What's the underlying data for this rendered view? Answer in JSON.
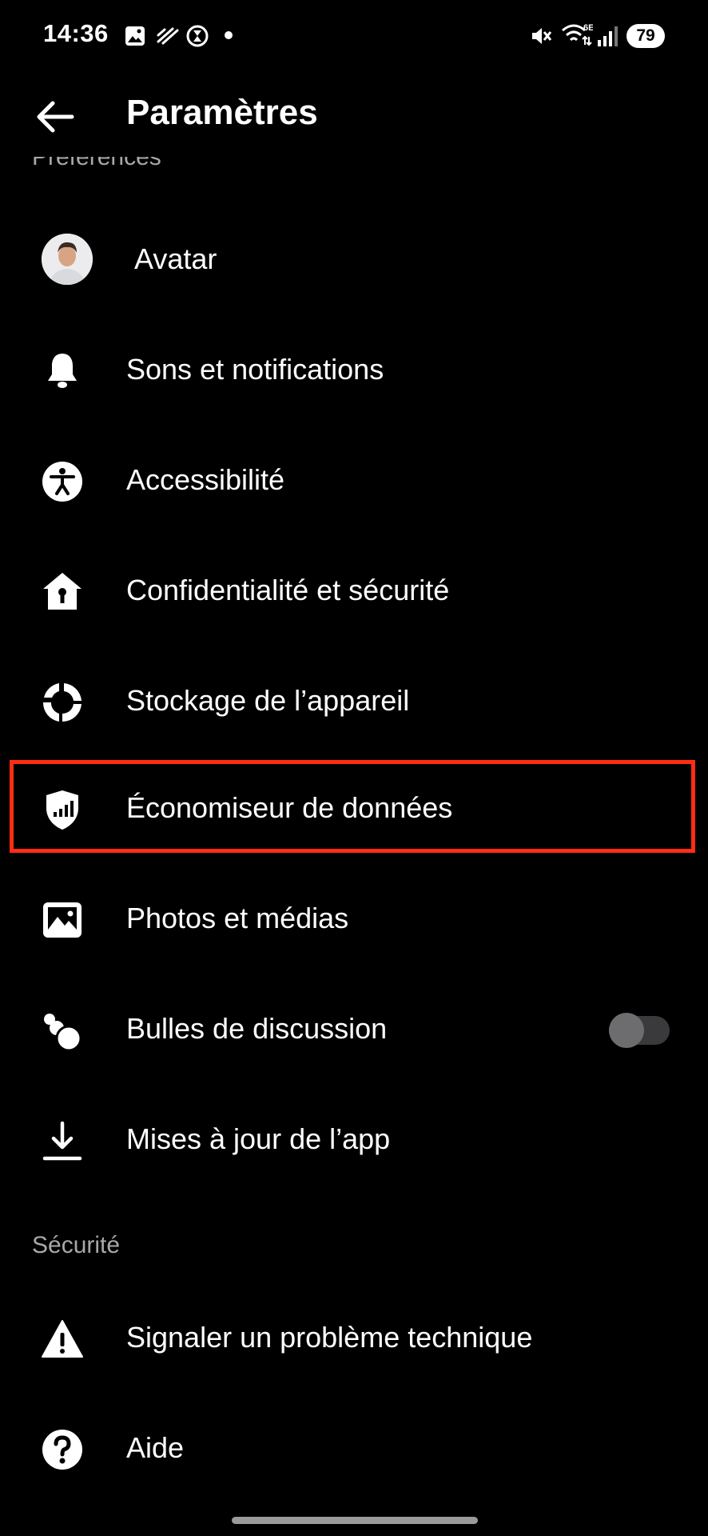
{
  "status_bar": {
    "time": "14:36",
    "battery": "79",
    "network": "6E",
    "left_icons": [
      "image-icon",
      "no-signal-icon",
      "hourglass-icon",
      "dot-icon"
    ],
    "right_icons": [
      "mute-icon",
      "wifi-icon",
      "signal-icon",
      "battery-icon"
    ]
  },
  "header": {
    "title": "Paramètres",
    "back_icon": "arrow-left-icon"
  },
  "sections": {
    "preferences_title": "Préférences",
    "security_title": "Sécurité"
  },
  "items": [
    {
      "label": "Avatar",
      "icon": "avatar-image"
    },
    {
      "label": "Sons et notifications",
      "icon": "bell-icon"
    },
    {
      "label": "Accessibilité",
      "icon": "accessibility-icon"
    },
    {
      "label": "Confidentialité et sécurité",
      "icon": "house-lock-icon"
    },
    {
      "label": "Stockage de l’appareil",
      "icon": "storage-icon"
    },
    {
      "label": "Économiseur de données",
      "icon": "shield-chart-icon",
      "highlighted": true
    },
    {
      "label": "Photos et médias",
      "icon": "photo-icon"
    },
    {
      "label": "Bulles de discussion",
      "icon": "bubbles-icon",
      "toggle": false
    },
    {
      "label": "Mises à jour de l’app",
      "icon": "download-icon"
    },
    {
      "label": "Signaler un problème technique",
      "icon": "warning-icon"
    },
    {
      "label": "Aide",
      "icon": "help-icon"
    }
  ],
  "colors": {
    "background": "#000000",
    "text": "#ffffff",
    "muted_text": "#a8a8a8",
    "highlight_border": "#ff2d14"
  }
}
